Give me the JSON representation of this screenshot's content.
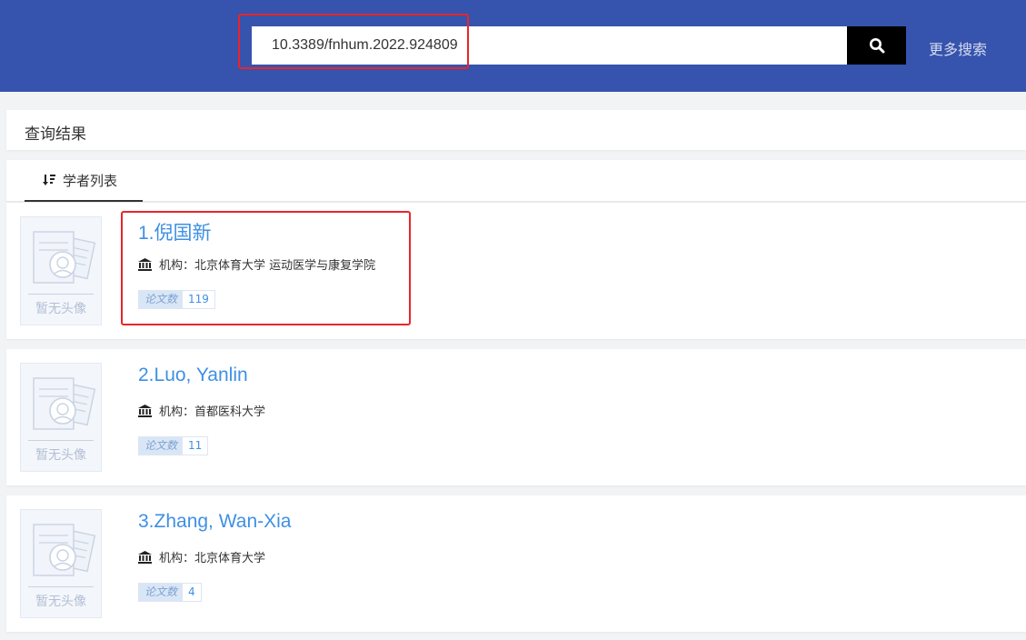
{
  "header": {
    "search_value": "10.3389/fnhum.2022.924809",
    "more_search_label": "更多搜索"
  },
  "results_title": "查询结果",
  "tab_label": "学者列表",
  "results": [
    {
      "name": "1.倪国新",
      "org_label": "机构：",
      "org": "北京体育大学 运动医学与康复学院",
      "badge_label": "论文数",
      "count": "119",
      "avatar_caption": "暂无头像"
    },
    {
      "name": "2.Luo, Yanlin",
      "org_label": "机构：",
      "org": "首都医科大学",
      "badge_label": "论文数",
      "count": "11",
      "avatar_caption": "暂无头像"
    },
    {
      "name": "3.Zhang, Wan-Xia",
      "org_label": "机构：",
      "org": "北京体育大学",
      "badge_label": "论文数",
      "count": "4",
      "avatar_caption": "暂无头像"
    }
  ]
}
